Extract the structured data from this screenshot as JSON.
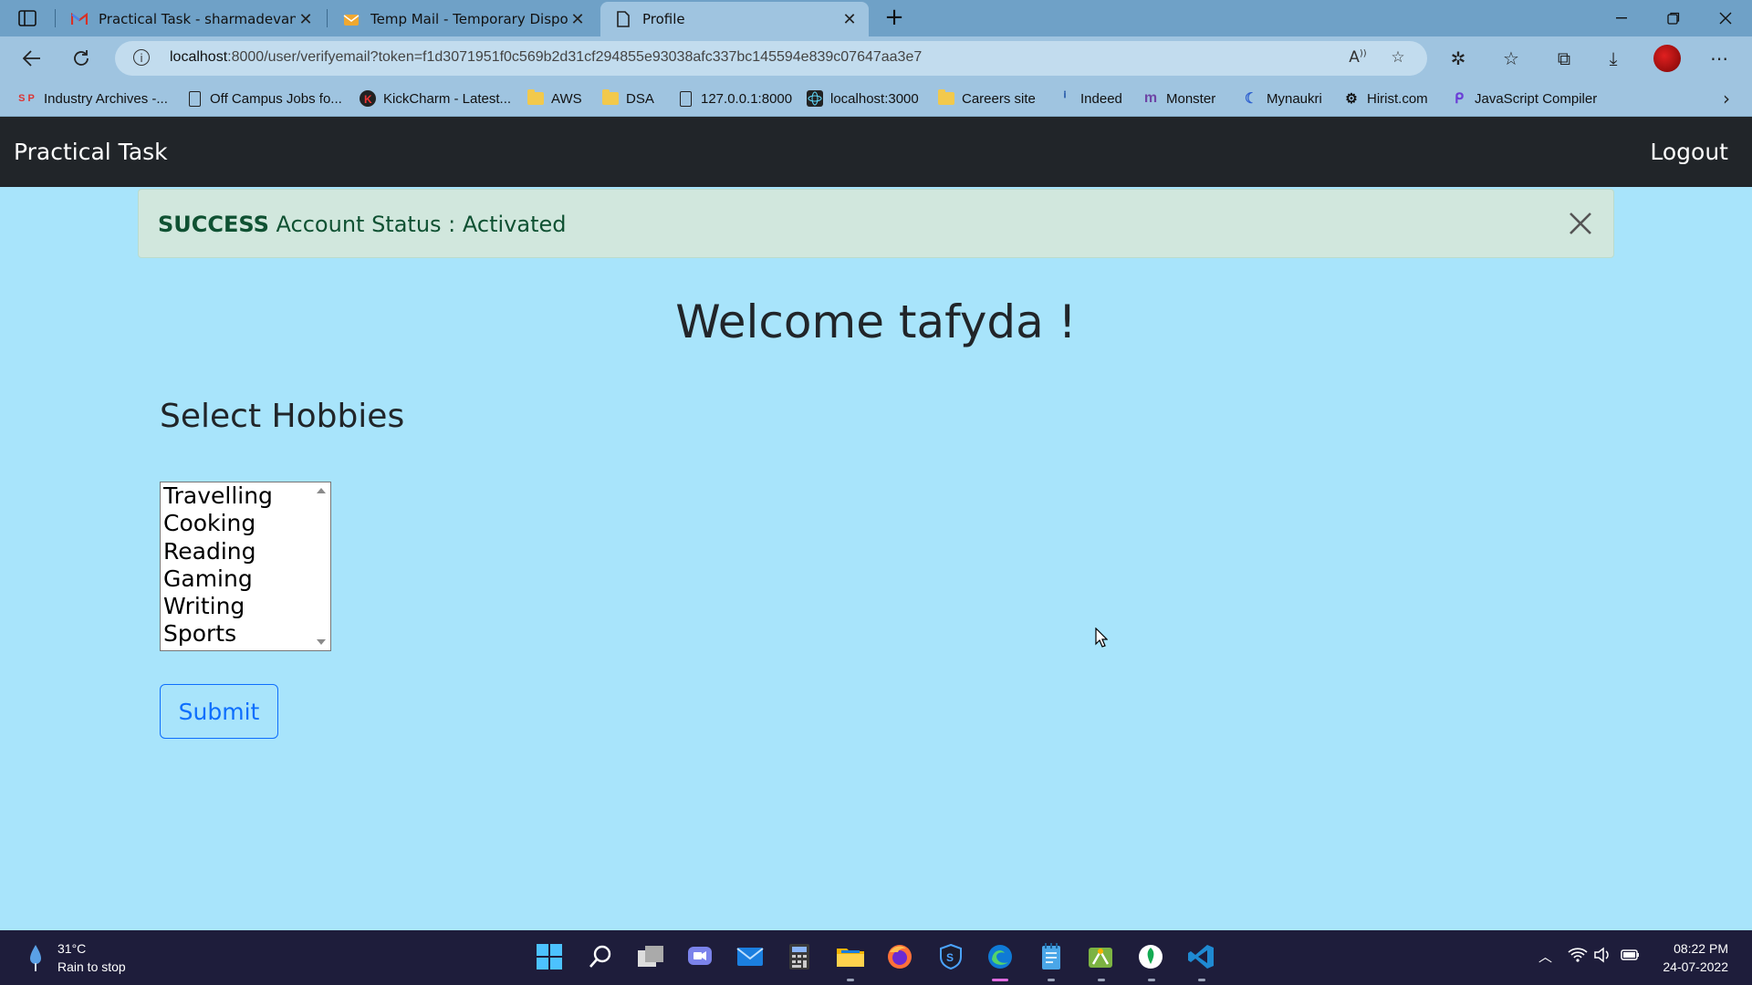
{
  "browser": {
    "tabs": [
      {
        "title": "Practical Task - sharmadevanand",
        "icon": "gmail-icon",
        "active": false
      },
      {
        "title": "Temp Mail - Temporary Disposab",
        "icon": "tempmail-icon",
        "active": false
      },
      {
        "title": "Profile",
        "icon": "page-icon",
        "active": true
      }
    ],
    "url_host": "localhost",
    "url_rest": ":8000/user/verifyemail?token=f1d3071951f0c569b2d31cf294855e93038afc337bc145594e839c07647aa3e7",
    "bookmarks": [
      {
        "label": "Industry Archives -...",
        "icon": "sp-icon"
      },
      {
        "label": "Off Campus Jobs fo...",
        "icon": "page-icon"
      },
      {
        "label": "KickCharm - Latest...",
        "icon": "kickcharm-icon"
      },
      {
        "label": "AWS",
        "icon": "folder-icon"
      },
      {
        "label": "DSA",
        "icon": "folder-icon"
      },
      {
        "label": "127.0.0.1:8000",
        "icon": "page-icon"
      },
      {
        "label": "localhost:3000",
        "icon": "react-icon"
      },
      {
        "label": "Careers site",
        "icon": "folder-icon"
      },
      {
        "label": "Indeed",
        "icon": "indeed-icon"
      },
      {
        "label": "Monster",
        "icon": "monster-icon"
      },
      {
        "label": "Mynaukri",
        "icon": "mynaukri-icon"
      },
      {
        "label": "Hirist.com",
        "icon": "hirist-icon"
      },
      {
        "label": "JavaScript Compiler",
        "icon": "programiz-icon"
      }
    ]
  },
  "navbar": {
    "brand": "Practical Task",
    "logout": "Logout"
  },
  "alert": {
    "strong": "SUCCESS",
    "message": "Account Status : Activated"
  },
  "main": {
    "welcome": "Welcome tafyda !",
    "hobbies_title": "Select Hobbies",
    "hobbies": [
      "Travelling",
      "Cooking",
      "Reading",
      "Gaming",
      "Writing",
      "Sports"
    ],
    "submit_label": "Submit"
  },
  "taskbar": {
    "weather_temp": "31°C",
    "weather_desc": "Rain to stop",
    "time": "08:22 PM",
    "date": "24-07-2022"
  }
}
